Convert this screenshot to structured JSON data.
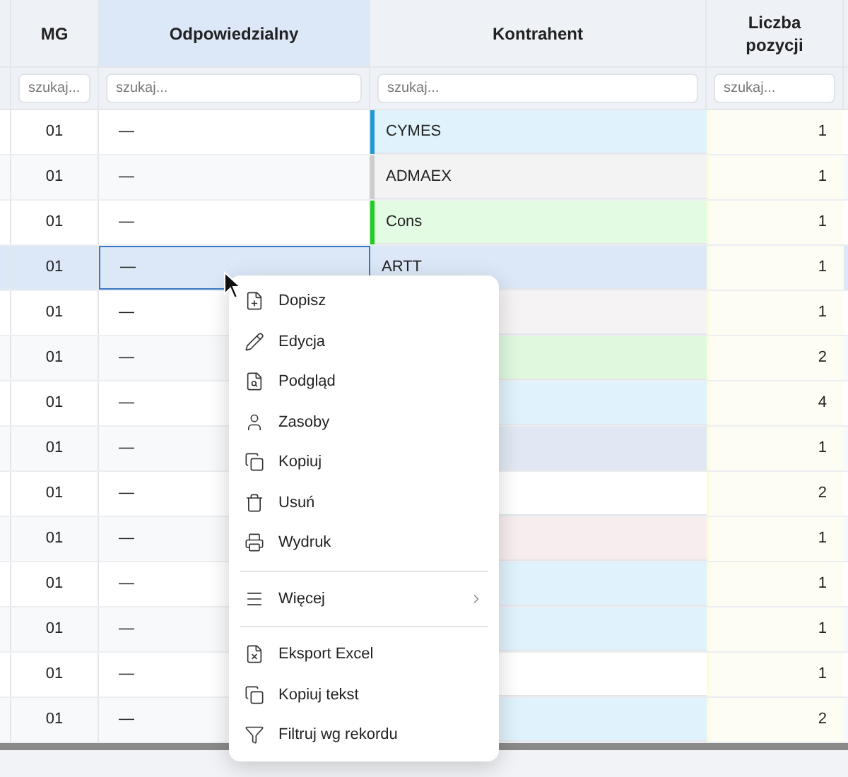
{
  "columns": [
    {
      "label": "MG",
      "selected": false,
      "placeholder": "szukaj..."
    },
    {
      "label": "Odpowiedzialny",
      "selected": true,
      "placeholder": "szukaj..."
    },
    {
      "label": "Kontrahent",
      "selected": false,
      "placeholder": "szukaj..."
    },
    {
      "label": "Liczba pozycji",
      "selected": false,
      "placeholder": "szukaj..."
    }
  ],
  "rows": [
    {
      "mg": "01",
      "responsible": "—",
      "contractor": "CYMES",
      "count": "1",
      "color": "#e0f2fb",
      "stripe": {
        "color": "#1e9bd7"
      },
      "selected": false
    },
    {
      "mg": "01",
      "responsible": "—",
      "contractor": "ADMAEX",
      "count": "1",
      "color": "#f3f3f3",
      "stripe": {
        "color": "#cccccc"
      },
      "selected": false
    },
    {
      "mg": "01",
      "responsible": "—",
      "contractor": "Cons",
      "count": "1",
      "color": "#e3fbe3",
      "stripe": {
        "color": "#22cc22"
      },
      "selected": false
    },
    {
      "mg": "01",
      "responsible": "—",
      "contractor": "ARTT",
      "count": "1",
      "color": "#dce8f7",
      "selected": true
    },
    {
      "mg": "01",
      "responsible": "—",
      "count": "1",
      "color": "#f6f3f4",
      "selected": false
    },
    {
      "mg": "01",
      "responsible": "—",
      "count": "2",
      "color": "#dff8de",
      "selected": false
    },
    {
      "mg": "01",
      "responsible": "—",
      "count": "4",
      "color": "#e0f2fb",
      "selected": false
    },
    {
      "mg": "01",
      "responsible": "—",
      "count": "1",
      "color": "#e0e9f3",
      "selected": false
    },
    {
      "mg": "01",
      "responsible": "—",
      "count": "2",
      "color": "#ffffff",
      "selected": false
    },
    {
      "mg": "01",
      "responsible": "—",
      "count": "1",
      "color": "#f7ecee",
      "selected": false
    },
    {
      "mg": "01",
      "responsible": "—",
      "count": "1",
      "color": "#e0f2fb",
      "selected": false
    },
    {
      "mg": "01",
      "responsible": "—",
      "count": "1",
      "color": "#e0f2fb",
      "selected": false
    },
    {
      "mg": "01",
      "responsible": "—",
      "count": "1",
      "color": "#ffffff",
      "selected": false
    },
    {
      "mg": "01",
      "responsible": "—",
      "count": "2",
      "color": "#e0f2fb",
      "selected": false
    }
  ],
  "context_menu": [
    {
      "kind": "item",
      "label": "Dopisz"
    },
    {
      "kind": "item",
      "label": "Edycja"
    },
    {
      "kind": "item",
      "label": "Podgląd"
    },
    {
      "kind": "item",
      "label": "Zasoby"
    },
    {
      "kind": "item",
      "label": "Kopiuj"
    },
    {
      "kind": "item",
      "label": "Usuń"
    },
    {
      "kind": "item",
      "label": "Wydruk"
    },
    {
      "kind": "separator"
    },
    {
      "kind": "submenu",
      "label": "Więcej"
    },
    {
      "kind": "separator"
    },
    {
      "kind": "item",
      "label": "Eksport Excel"
    },
    {
      "kind": "item",
      "label": "Kopiuj tekst"
    },
    {
      "kind": "item",
      "label": "Filtruj wg rekordu"
    }
  ]
}
